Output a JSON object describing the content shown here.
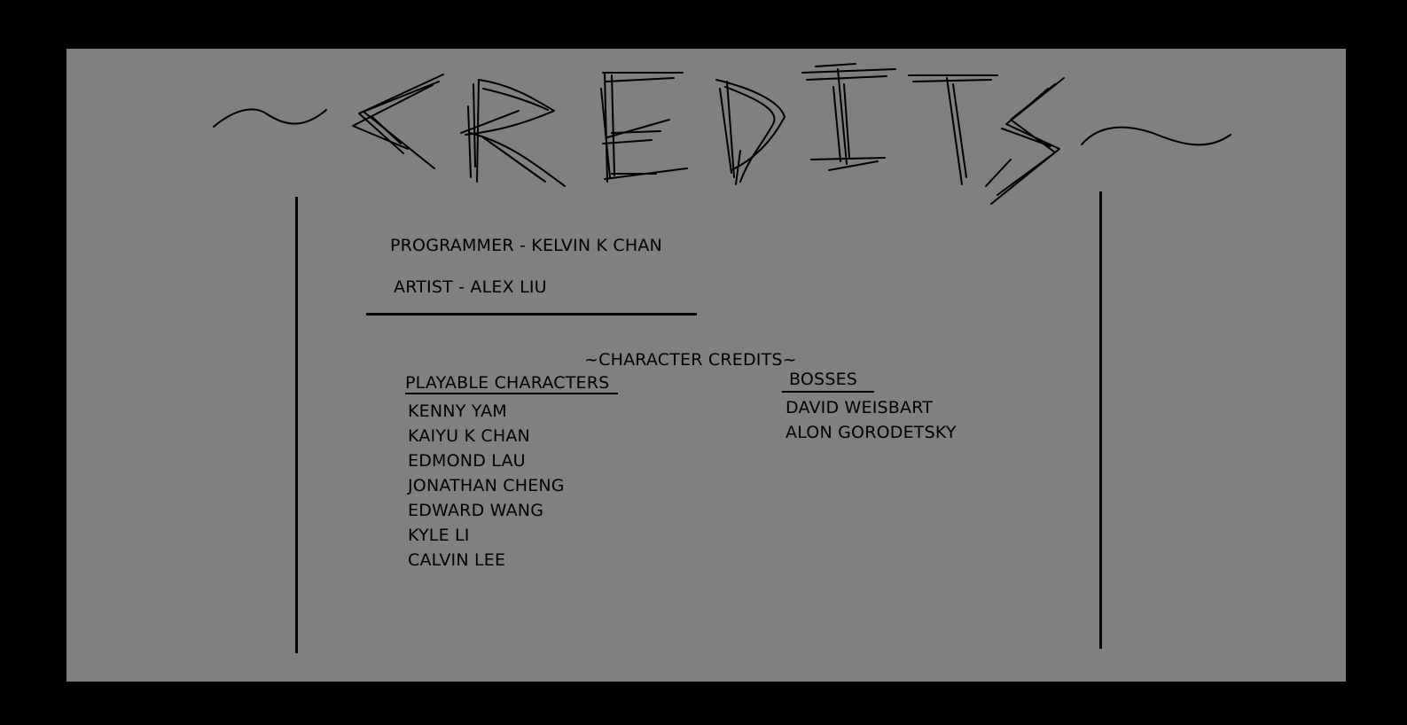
{
  "screen": {
    "title": "CREDITS",
    "colors": {
      "background": "#000000",
      "panel": "#808080",
      "ink": "#000000"
    }
  },
  "staff": {
    "programmer": "PROGRAMMER - KELVIN K CHAN",
    "artist": "ARTIST - ALEX LIU"
  },
  "character_credits": {
    "heading": "~CHARACTER CREDITS~",
    "playable": {
      "heading": "PLAYABLE CHARACTERS",
      "names": [
        "KENNY YAM",
        "KAIYU K CHAN",
        "EDMOND LAU",
        "JONATHAN CHENG",
        "EDWARD WANG",
        "KYLE LI",
        "CALVIN LEE"
      ]
    },
    "bosses": {
      "heading": "BOSSES",
      "names": [
        "DAVID WEISBART",
        "ALON GORODETSKY"
      ]
    }
  }
}
